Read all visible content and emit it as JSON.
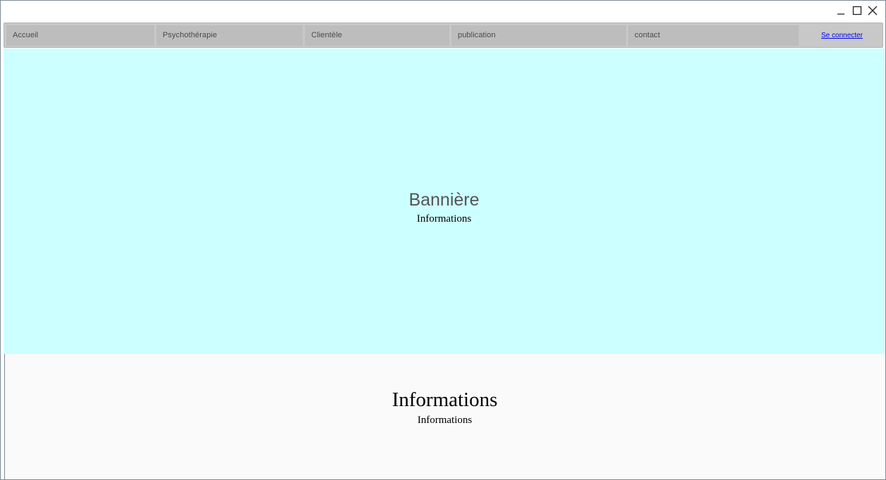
{
  "window": {
    "controls": {
      "minimize_icon": "minimize-icon",
      "maximize_icon": "maximize-icon",
      "close_icon": "close-icon"
    }
  },
  "nav": {
    "items": [
      {
        "label": "Accueil"
      },
      {
        "label": "Psychothérapie"
      },
      {
        "label": "Clientèle"
      },
      {
        "label": "publication"
      },
      {
        "label": "contact"
      }
    ],
    "login_link": "Se connecter"
  },
  "banner": {
    "title": "Bannière",
    "subtitle": "Informations",
    "background": "#ccffff"
  },
  "info": {
    "title": "Informations",
    "subtitle": "Informations",
    "background": "#fafafa"
  },
  "colors": {
    "nav_bar": "#c8c8c8",
    "nav_item": "#bdbdbd",
    "link": "#0000ee"
  }
}
